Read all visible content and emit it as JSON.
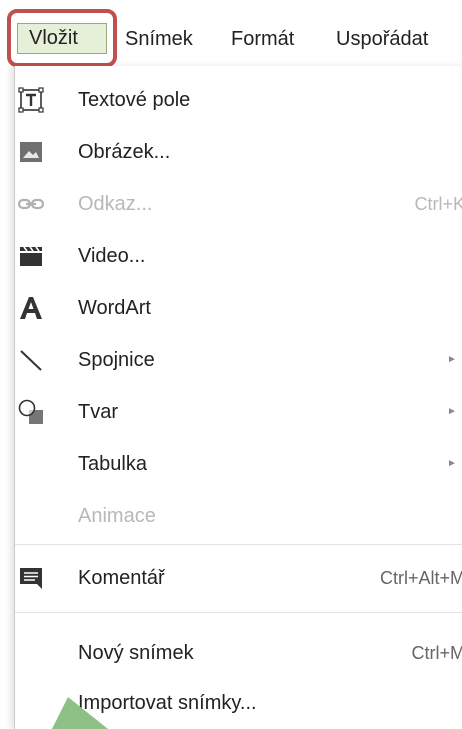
{
  "menubar": {
    "active_menu": "Vložit",
    "items": [
      "Snímek",
      "Formát",
      "Uspořádat"
    ]
  },
  "menu": {
    "items": [
      {
        "label": "Textové pole",
        "icon": "text-box-icon",
        "enabled": true
      },
      {
        "label": "Obrázek...",
        "icon": "image-icon",
        "enabled": true
      },
      {
        "label": "Odkaz...",
        "icon": "link-icon",
        "enabled": false,
        "shortcut": "Ctrl+K"
      },
      {
        "label": "Video...",
        "icon": "video-clapperboard-icon",
        "enabled": true
      },
      {
        "label": "WordArt",
        "icon": "wordart-icon",
        "enabled": true
      },
      {
        "label": "Spojnice",
        "icon": "line-icon",
        "enabled": true,
        "submenu": true
      },
      {
        "label": "Tvar",
        "icon": "shape-icon",
        "enabled": true,
        "submenu": true
      },
      {
        "label": "Tabulka",
        "enabled": true,
        "submenu": true
      },
      {
        "label": "Animace",
        "enabled": false
      },
      {
        "label": "Komentář",
        "icon": "comment-icon",
        "enabled": true,
        "shortcut": "Ctrl+Alt+M"
      },
      {
        "label": "Nový snímek",
        "enabled": true,
        "shortcut": "Ctrl+M"
      },
      {
        "label": "Importovat snímky...",
        "enabled": true
      }
    ],
    "submenu_arrow": "►"
  },
  "colors": {
    "highlight_border": "#c0504d",
    "highlight_fill": "#e6efd8",
    "pointer": "#8cc084"
  }
}
